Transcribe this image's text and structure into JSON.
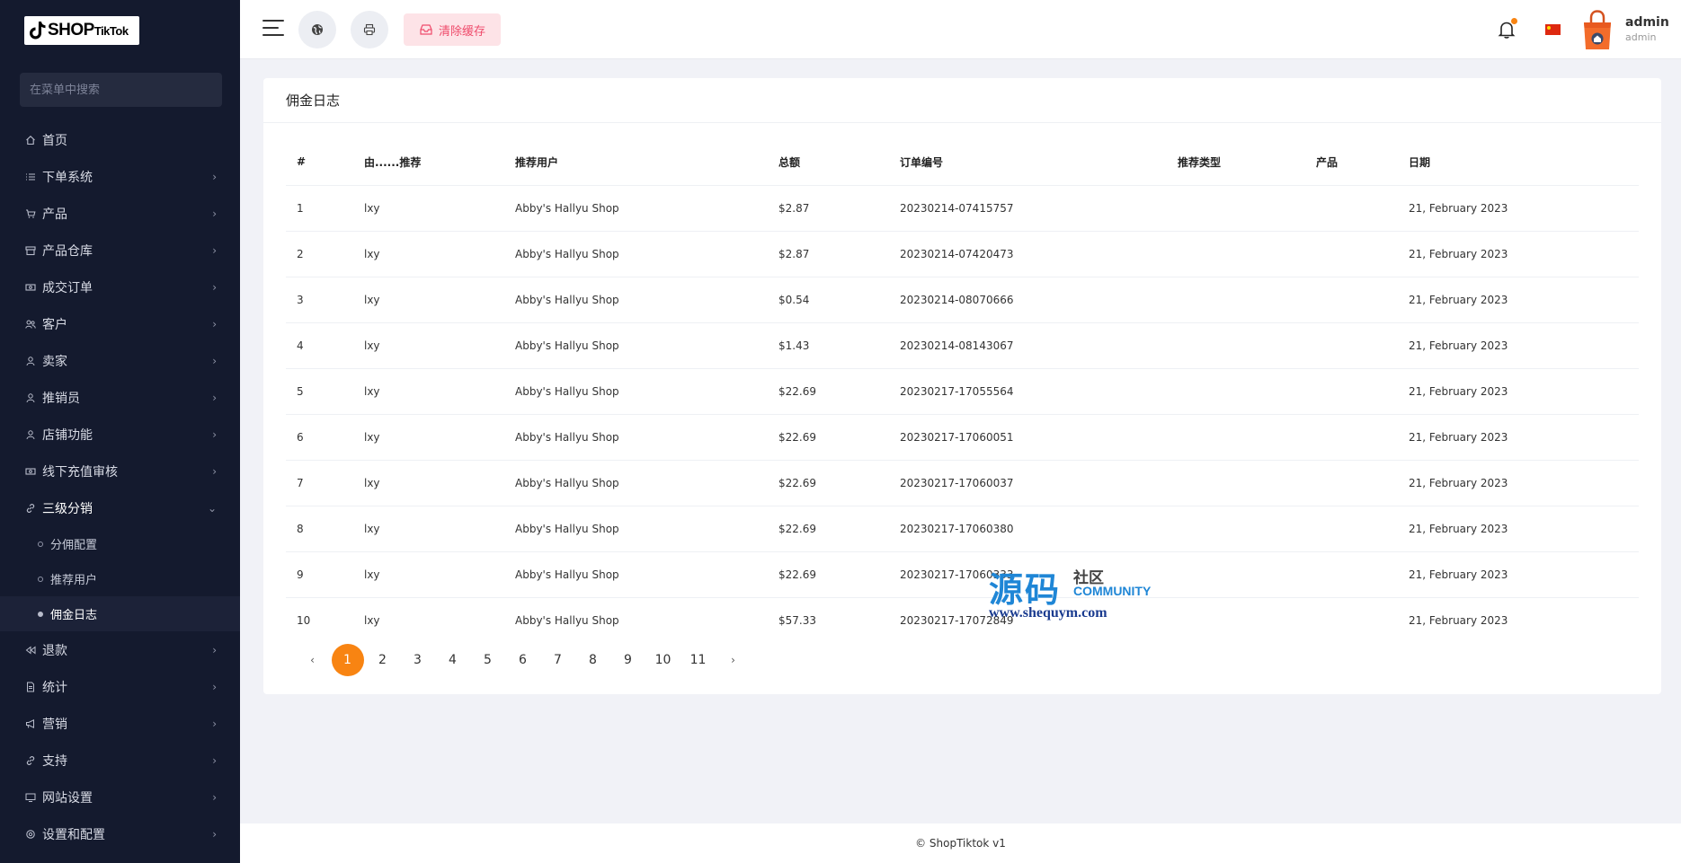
{
  "brand": {
    "logo_main": "SHOP",
    "logo_sub": "TikTok"
  },
  "sidebar": {
    "search_placeholder": "在菜单中搜索",
    "items": [
      {
        "label": "首页",
        "icon": "home-icon",
        "has_children": false
      },
      {
        "label": "下单系统",
        "icon": "list-icon",
        "has_children": true
      },
      {
        "label": "产品",
        "icon": "cart-icon",
        "has_children": true
      },
      {
        "label": "产品仓库",
        "icon": "archive-icon",
        "has_children": true
      },
      {
        "label": "成交订单",
        "icon": "money-icon",
        "has_children": true
      },
      {
        "label": "客户",
        "icon": "users-icon",
        "has_children": true
      },
      {
        "label": "卖家",
        "icon": "user-icon",
        "has_children": true
      },
      {
        "label": "推销员",
        "icon": "user-icon",
        "has_children": true
      },
      {
        "label": "店铺功能",
        "icon": "user-icon",
        "has_children": true
      },
      {
        "label": "线下充值审核",
        "icon": "money-icon",
        "has_children": true
      },
      {
        "label": "三级分销",
        "icon": "link-icon",
        "has_children": true,
        "open": true
      }
    ],
    "submenu": [
      {
        "label": "分佣配置",
        "active": false
      },
      {
        "label": "推荐用户",
        "active": false
      },
      {
        "label": "佣金日志",
        "active": true
      }
    ],
    "items_after": [
      {
        "label": "退款",
        "icon": "rewind-icon"
      },
      {
        "label": "统计",
        "icon": "file-icon"
      },
      {
        "label": "营销",
        "icon": "megaphone-icon"
      },
      {
        "label": "支持",
        "icon": "link-icon"
      },
      {
        "label": "网站设置",
        "icon": "monitor-icon"
      },
      {
        "label": "设置和配置",
        "icon": "gear-icon"
      }
    ]
  },
  "topbar": {
    "clear_cache_label": "清除缓存",
    "user_name": "admin",
    "user_role": "admin",
    "colors": {
      "accent": "#f88412",
      "danger": "#ef4b6b",
      "sidebar": "#141a2e"
    }
  },
  "page": {
    "title": "佣金日志",
    "columns": [
      "#",
      "由......推荐",
      "推荐用户",
      "总额",
      "订单编号",
      "推荐类型",
      "产品",
      "日期"
    ],
    "rows": [
      [
        "1",
        "lxy",
        "Abby's Hallyu Shop",
        "$2.87",
        "20230214-07415757",
        "",
        "",
        "21, February 2023"
      ],
      [
        "2",
        "lxy",
        "Abby's Hallyu Shop",
        "$2.87",
        "20230214-07420473",
        "",
        "",
        "21, February 2023"
      ],
      [
        "3",
        "lxy",
        "Abby's Hallyu Shop",
        "$0.54",
        "20230214-08070666",
        "",
        "",
        "21, February 2023"
      ],
      [
        "4",
        "lxy",
        "Abby's Hallyu Shop",
        "$1.43",
        "20230214-08143067",
        "",
        "",
        "21, February 2023"
      ],
      [
        "5",
        "lxy",
        "Abby's Hallyu Shop",
        "$22.69",
        "20230217-17055564",
        "",
        "",
        "21, February 2023"
      ],
      [
        "6",
        "lxy",
        "Abby's Hallyu Shop",
        "$22.69",
        "20230217-17060051",
        "",
        "",
        "21, February 2023"
      ],
      [
        "7",
        "lxy",
        "Abby's Hallyu Shop",
        "$22.69",
        "20230217-17060037",
        "",
        "",
        "21, February 2023"
      ],
      [
        "8",
        "lxy",
        "Abby's Hallyu Shop",
        "$22.69",
        "20230217-17060380",
        "",
        "",
        "21, February 2023"
      ],
      [
        "9",
        "lxy",
        "Abby's Hallyu Shop",
        "$22.69",
        "20230217-17060333",
        "",
        "",
        "21, February 2023"
      ],
      [
        "10",
        "lxy",
        "Abby's Hallyu Shop",
        "$57.33",
        "20230217-17072849",
        "",
        "",
        "21, February 2023"
      ]
    ],
    "pagination": {
      "prev": "‹",
      "next": "›",
      "pages": [
        "1",
        "2",
        "3",
        "4",
        "5",
        "6",
        "7",
        "8",
        "9",
        "10",
        "11"
      ],
      "current": "1"
    }
  },
  "watermark": {
    "main": "源码",
    "sub": "社区",
    "en": "COMMUNITY",
    "url": "www.shequym.com"
  },
  "footer": {
    "text": "© ShopTiktok v1"
  }
}
